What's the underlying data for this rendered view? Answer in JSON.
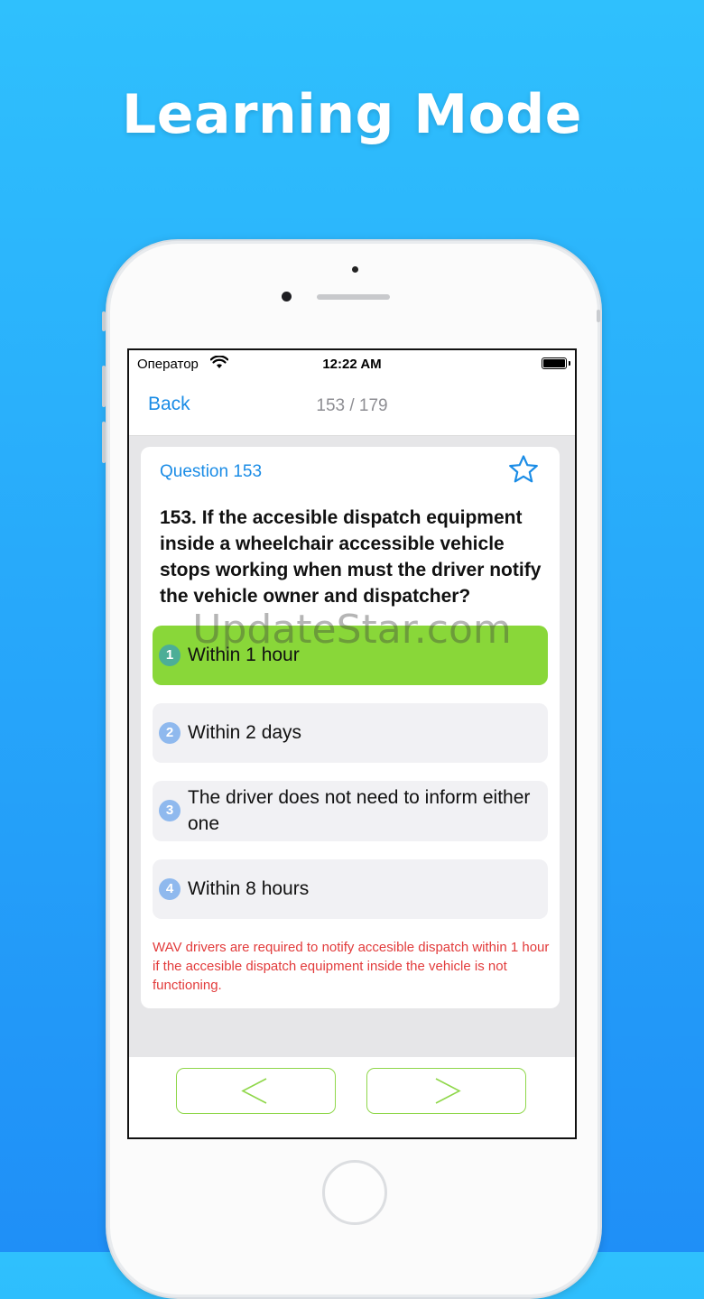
{
  "headline": "Learning Mode",
  "status_bar": {
    "carrier": "Оператор",
    "time": "12:22 AM"
  },
  "nav": {
    "back_label": "Back",
    "counter": "153 / 179"
  },
  "question": {
    "label": "Question 153",
    "text": "153. If the accesible dispatch equipment inside a wheelchair accessible vehicle stops working when must the driver notify the vehicle owner and dispatcher?"
  },
  "options": [
    {
      "number": "1",
      "text": "Within 1 hour",
      "state": "correct"
    },
    {
      "number": "2",
      "text": "Within 2 days",
      "state": "default"
    },
    {
      "number": "3",
      "text": "The driver does not need to inform either one",
      "state": "default"
    },
    {
      "number": "4",
      "text": "Within 8 hours",
      "state": "default"
    }
  ],
  "explanation": "WAV drivers are required to notify accesible dispatch within 1 hour if the accesible dispatch equipment inside the vehicle is not functioning.",
  "watermark": "UpdateStar.com",
  "colors": {
    "accent": "#1a8ce6",
    "correct": "#89d739",
    "explanation": "#e23b3b",
    "nav_border": "#8fd74a"
  },
  "icons": {
    "favorite": "star-outline-icon",
    "previous": "chevron-left-icon",
    "next": "chevron-right-icon"
  }
}
